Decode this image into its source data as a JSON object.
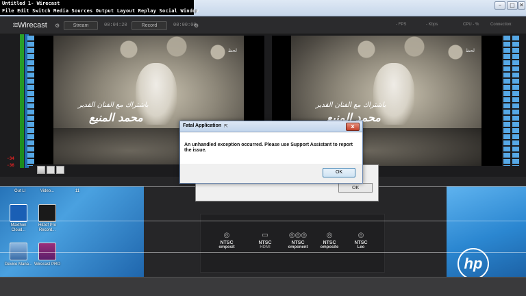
{
  "window": {
    "title": "Untitled 1- Wirecast",
    "menu": "File Edit Switch Media Sources Output Layout Replay Social Window",
    "menu_tail": "p"
  },
  "toolbar": {
    "logo": "Wirecast",
    "stream_label": "Stream",
    "stream_time": "00:04:20",
    "record_label": "Record",
    "record_time": "00:00:00",
    "fps": "- FPS",
    "kbps": "- Kbps",
    "cpu": "CPU - %",
    "connection": "Connection:"
  },
  "meter": {
    "red_top": "-34",
    "red_bottom": "-36"
  },
  "video": {
    "caption_top": "باشتراك مع الفنان القدير",
    "caption_name": "محمد المنيع",
    "channel_logo": "لحظ"
  },
  "dialog": {
    "title": "Fatal Application",
    "message": "An unhandled exception occurred. Please use Support Assistant to report the issue.",
    "ok": "OK",
    "close": "x"
  },
  "bg_dialog": {
    "ok": "OK"
  },
  "desktop": {
    "icons": [
      {
        "label": "Maxthon Cloud..."
      },
      {
        "label": "HiDef Pro Record..."
      },
      {
        "label": "Device Mana..."
      },
      {
        "label": "Wirecast PRO"
      }
    ],
    "top_labels": [
      "Out Ll",
      "Video...",
      "11"
    ],
    "brand": "hp"
  },
  "outputs": {
    "items": [
      {
        "name": "NTSC",
        "sub": "omposit"
      },
      {
        "name": "NTSC",
        "sub": "HDMI"
      },
      {
        "name": "NTSC",
        "sub": "omponent"
      },
      {
        "name": "NTSC",
        "sub": "omposite"
      },
      {
        "name": "NTSC",
        "sub": "Leo"
      }
    ]
  }
}
